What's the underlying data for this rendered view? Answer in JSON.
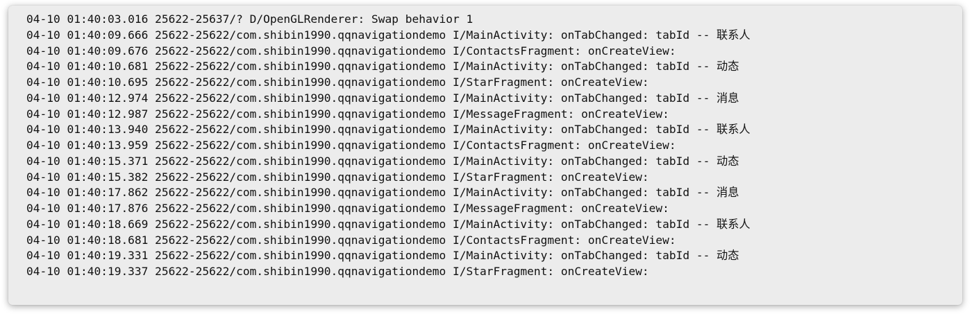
{
  "logcat": {
    "lines": [
      "04-10 01:40:03.016 25622-25637/? D/OpenGLRenderer: Swap behavior 1",
      "04-10 01:40:09.666 25622-25622/com.shibin1990.qqnavigationdemo I/MainActivity: onTabChanged: tabId -- 联系人",
      "04-10 01:40:09.676 25622-25622/com.shibin1990.qqnavigationdemo I/ContactsFragment: onCreateView:",
      "04-10 01:40:10.681 25622-25622/com.shibin1990.qqnavigationdemo I/MainActivity: onTabChanged: tabId -- 动态",
      "04-10 01:40:10.695 25622-25622/com.shibin1990.qqnavigationdemo I/StarFragment: onCreateView:",
      "04-10 01:40:12.974 25622-25622/com.shibin1990.qqnavigationdemo I/MainActivity: onTabChanged: tabId -- 消息",
      "04-10 01:40:12.987 25622-25622/com.shibin1990.qqnavigationdemo I/MessageFragment: onCreateView:",
      "04-10 01:40:13.940 25622-25622/com.shibin1990.qqnavigationdemo I/MainActivity: onTabChanged: tabId -- 联系人",
      "04-10 01:40:13.959 25622-25622/com.shibin1990.qqnavigationdemo I/ContactsFragment: onCreateView:",
      "04-10 01:40:15.371 25622-25622/com.shibin1990.qqnavigationdemo I/MainActivity: onTabChanged: tabId -- 动态",
      "04-10 01:40:15.382 25622-25622/com.shibin1990.qqnavigationdemo I/StarFragment: onCreateView:",
      "04-10 01:40:17.862 25622-25622/com.shibin1990.qqnavigationdemo I/MainActivity: onTabChanged: tabId -- 消息",
      "04-10 01:40:17.876 25622-25622/com.shibin1990.qqnavigationdemo I/MessageFragment: onCreateView:",
      "04-10 01:40:18.669 25622-25622/com.shibin1990.qqnavigationdemo I/MainActivity: onTabChanged: tabId -- 联系人",
      "04-10 01:40:18.681 25622-25622/com.shibin1990.qqnavigationdemo I/ContactsFragment: onCreateView:",
      "04-10 01:40:19.331 25622-25622/com.shibin1990.qqnavigationdemo I/MainActivity: onTabChanged: tabId -- 动态",
      "04-10 01:40:19.337 25622-25622/com.shibin1990.qqnavigationdemo I/StarFragment: onCreateView:"
    ]
  }
}
